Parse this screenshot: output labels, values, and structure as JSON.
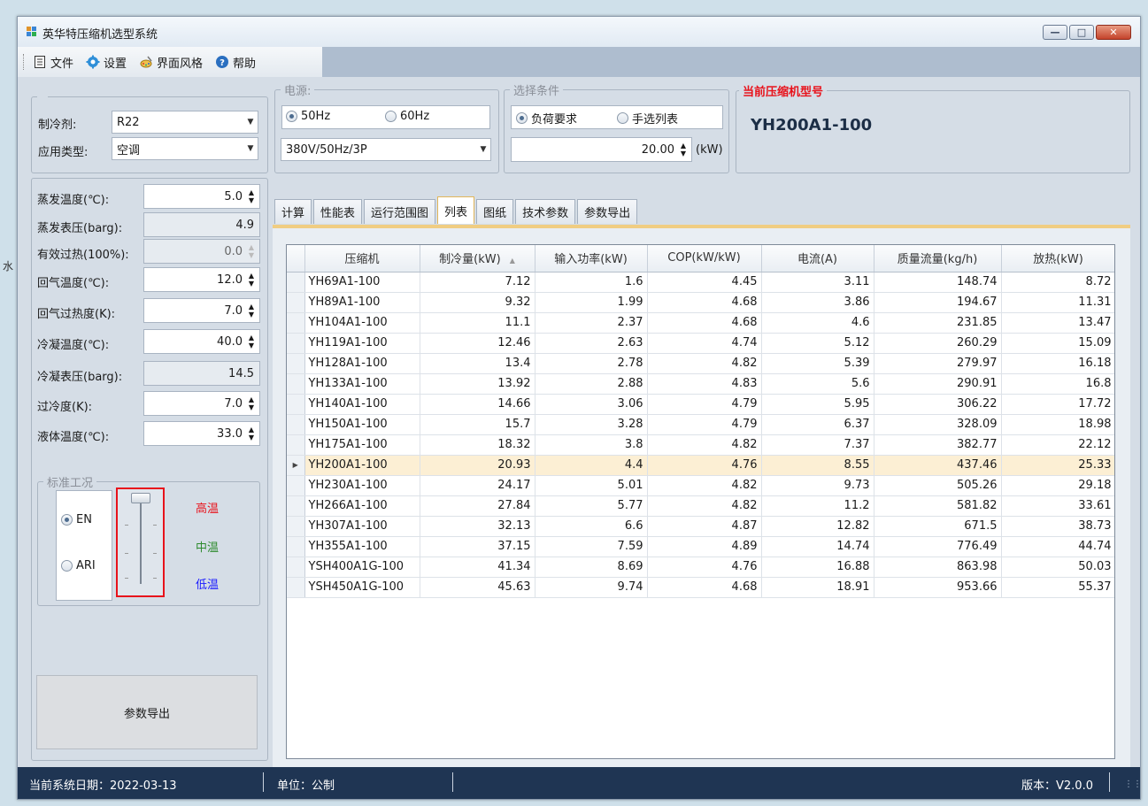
{
  "window": {
    "title": "英华特压缩机选型系统"
  },
  "menu": {
    "file": "文件",
    "settings": "设置",
    "theme": "界面风格",
    "help": "帮助"
  },
  "refrigerant": {
    "label": "制冷剂:",
    "value": "R22"
  },
  "app_type": {
    "label": "应用类型:",
    "value": "空调"
  },
  "power": {
    "legend": "电源:",
    "opt_50": "50Hz",
    "opt_60": "60Hz",
    "selected": "50Hz",
    "voltage": "380V/50Hz/3P"
  },
  "selection": {
    "legend": "选择条件",
    "opt_load": "负荷要求",
    "opt_manual": "手选列表",
    "selected": "负荷要求",
    "load_value": "20.00",
    "unit": "(kW)"
  },
  "current_model": {
    "legend": "当前压缩机型号",
    "value": "YH200A1-100"
  },
  "params": [
    {
      "label": "蒸发温度(℃):",
      "value": "5.0",
      "kind": "spin"
    },
    {
      "label": "蒸发表压(barg):",
      "value": "4.9",
      "kind": "readonly"
    },
    {
      "label": "有效过热(100%):",
      "value": "0.0",
      "kind": "disabled"
    },
    {
      "label": "回气温度(℃):",
      "value": "12.0",
      "kind": "spin"
    },
    {
      "label": "回气过热度(K):",
      "value": "7.0",
      "kind": "spin"
    },
    {
      "label": "冷凝温度(℃):",
      "value": "40.0",
      "kind": "spin"
    },
    {
      "label": "冷凝表压(barg):",
      "value": "14.5",
      "kind": "readonly"
    },
    {
      "label": "过冷度(K):",
      "value": "7.0",
      "kind": "spin"
    },
    {
      "label": "液体温度(℃):",
      "value": "33.0",
      "kind": "spin"
    }
  ],
  "standard": {
    "legend": "标准工况",
    "opt_en": "EN",
    "opt_ari": "ARI",
    "selected": "EN",
    "high": "高温",
    "mid": "中温",
    "low": "低温",
    "colors": {
      "high": "#e8121b",
      "mid": "#2e8b2e",
      "low": "#1a1aff"
    }
  },
  "export_button": "参数导出",
  "tabs": [
    {
      "label": "计算"
    },
    {
      "label": "性能表"
    },
    {
      "label": "运行范围图"
    },
    {
      "label": "列表",
      "active": true
    },
    {
      "label": "图纸"
    },
    {
      "label": "技术参数"
    },
    {
      "label": "参数导出"
    }
  ],
  "table": {
    "columns": [
      "压缩机",
      "制冷量(kW)",
      "输入功率(kW)",
      "COP(kW/kW)",
      "电流(A)",
      "质量流量(kg/h)",
      "放热(kW)"
    ],
    "sort_indicator": "▲",
    "selected_row": "YH200A1-100",
    "rows": [
      [
        "YH69A1-100",
        "7.12",
        "1.6",
        "4.45",
        "3.11",
        "148.74",
        "8.72"
      ],
      [
        "YH89A1-100",
        "9.32",
        "1.99",
        "4.68",
        "3.86",
        "194.67",
        "11.31"
      ],
      [
        "YH104A1-100",
        "11.1",
        "2.37",
        "4.68",
        "4.6",
        "231.85",
        "13.47"
      ],
      [
        "YH119A1-100",
        "12.46",
        "2.63",
        "4.74",
        "5.12",
        "260.29",
        "15.09"
      ],
      [
        "YH128A1-100",
        "13.4",
        "2.78",
        "4.82",
        "5.39",
        "279.97",
        "16.18"
      ],
      [
        "YH133A1-100",
        "13.92",
        "2.88",
        "4.83",
        "5.6",
        "290.91",
        "16.8"
      ],
      [
        "YH140A1-100",
        "14.66",
        "3.06",
        "4.79",
        "5.95",
        "306.22",
        "17.72"
      ],
      [
        "YH150A1-100",
        "15.7",
        "3.28",
        "4.79",
        "6.37",
        "328.09",
        "18.98"
      ],
      [
        "YH175A1-100",
        "18.32",
        "3.8",
        "4.82",
        "7.37",
        "382.77",
        "22.12"
      ],
      [
        "YH200A1-100",
        "20.93",
        "4.4",
        "4.76",
        "8.55",
        "437.46",
        "25.33"
      ],
      [
        "YH230A1-100",
        "24.17",
        "5.01",
        "4.82",
        "9.73",
        "505.26",
        "29.18"
      ],
      [
        "YH266A1-100",
        "27.84",
        "5.77",
        "4.82",
        "11.2",
        "581.82",
        "33.61"
      ],
      [
        "YH307A1-100",
        "32.13",
        "6.6",
        "4.87",
        "12.82",
        "671.5",
        "38.73"
      ],
      [
        "YH355A1-100",
        "37.15",
        "7.59",
        "4.89",
        "14.74",
        "776.49",
        "44.74"
      ],
      [
        "YSH400A1G-100",
        "41.34",
        "8.69",
        "4.76",
        "16.88",
        "863.98",
        "50.03"
      ],
      [
        "YSH450A1G-100",
        "45.63",
        "9.74",
        "4.68",
        "18.91",
        "953.66",
        "55.37"
      ]
    ]
  },
  "status": {
    "date": "当前系统日期：2022-03-13",
    "unit": "单位：公制",
    "version": "版本：V2.0.0"
  },
  "bg_fragment": "水",
  "accent_red": "#e8121b"
}
